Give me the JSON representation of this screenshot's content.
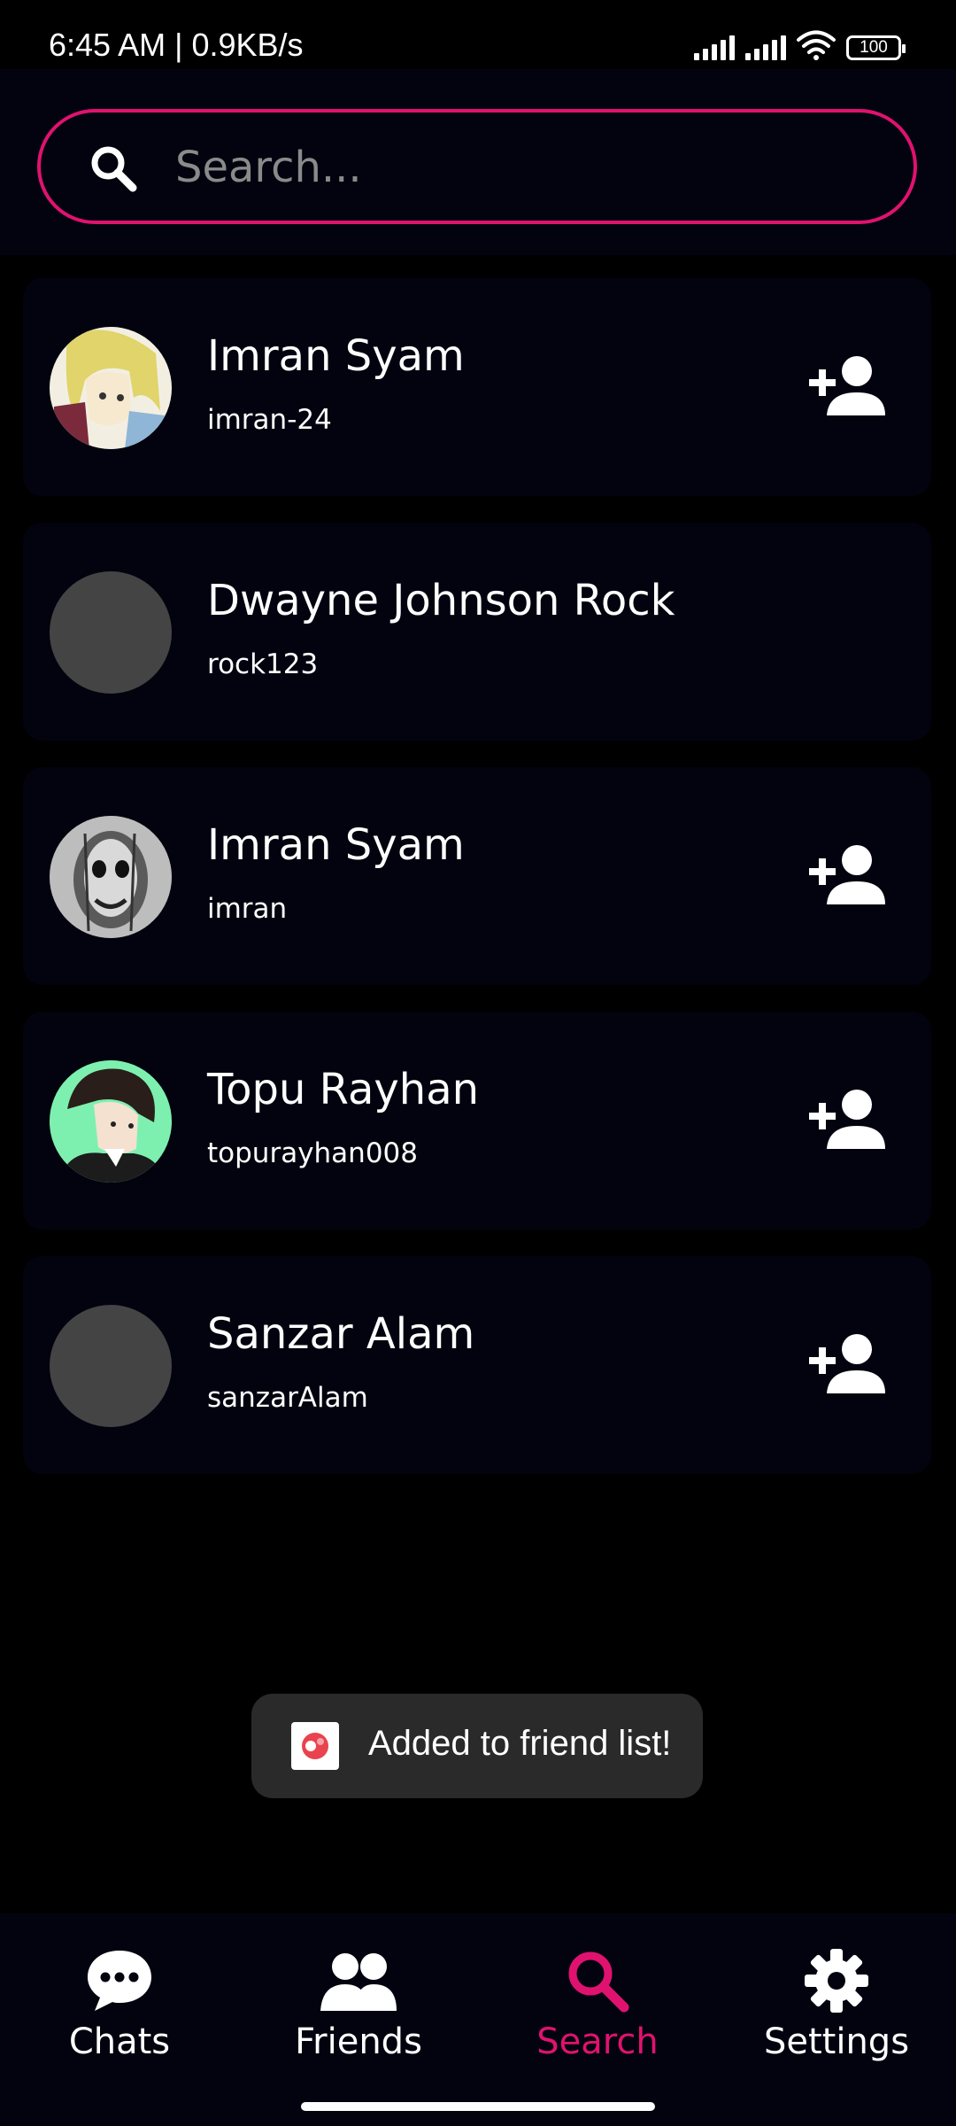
{
  "status_bar": {
    "time_speed": "6:45 AM | 0.9KB/s",
    "battery": "100"
  },
  "search": {
    "placeholder": "Search...",
    "value": "",
    "accent_color": "#e0126f"
  },
  "results": [
    {
      "name": "Imran Syam",
      "username": "imran-24",
      "avatar": "anime-blonde",
      "has_add_button": true
    },
    {
      "name": "Dwayne Johnson Rock",
      "username": "rock123",
      "avatar": "placeholder-gray",
      "has_add_button": false
    },
    {
      "name": "Imran Syam",
      "username": "imran",
      "avatar": "grayscale-face",
      "has_add_button": true
    },
    {
      "name": "Topu Rayhan",
      "username": "topurayhan008",
      "avatar": "anime-dark-hair",
      "has_add_button": true
    },
    {
      "name": "Sanzar Alam",
      "username": "sanzarAlam",
      "avatar": "placeholder-gray",
      "has_add_button": true
    }
  ],
  "toast": {
    "message": "Added to friend list!"
  },
  "bottom_nav": {
    "items": [
      {
        "label": "Chats",
        "icon": "chat-bubble-icon",
        "active": false
      },
      {
        "label": "Friends",
        "icon": "people-icon",
        "active": false
      },
      {
        "label": "Search",
        "icon": "search-icon",
        "active": true
      },
      {
        "label": "Settings",
        "icon": "gear-icon",
        "active": false
      }
    ]
  }
}
